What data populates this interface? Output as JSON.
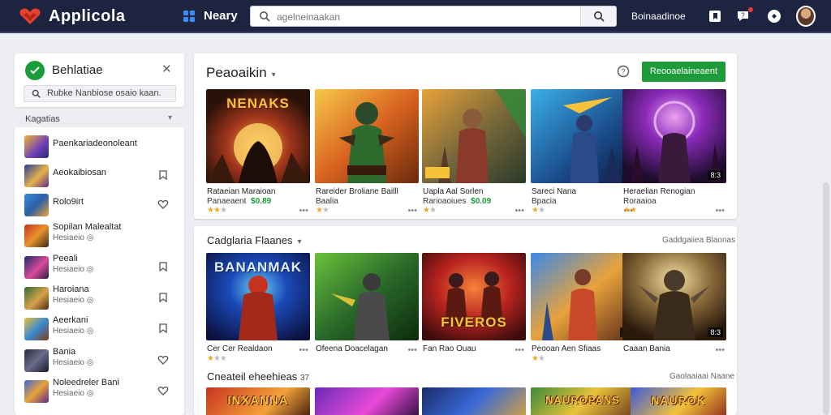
{
  "header": {
    "app_name": "Applicola",
    "nav_label": "Neary",
    "search_placeholder": "agelneinaakan",
    "top_link": "Boinaadinoe",
    "brand_color": "#1d2440"
  },
  "sidebar": {
    "title": "Behlatiae",
    "search_text": "Rubke Nanbiose osaio kaan.",
    "category_label": "Kagatias",
    "items": [
      {
        "name": "Paenkariadeonoleant",
        "sub": "",
        "action": "none"
      },
      {
        "name": "Aeokaibiosan",
        "sub": "",
        "action": "bookmark-icon"
      },
      {
        "name": "Rolo9irt",
        "sub": "",
        "action": "heart-icon"
      },
      {
        "name": "Sopilan Malealtat",
        "sub": "Hesiaeio ◎",
        "action": "none"
      },
      {
        "name": "Peeali",
        "sub": "Hesiaeio ◎",
        "action": "bookmark-icon"
      },
      {
        "name": "Haroiana",
        "sub": "Hesiaeio ◎",
        "action": "bookmark-icon"
      },
      {
        "name": "Aeerkani",
        "sub": "Hesiaeio ◎",
        "action": "bookmark-icon"
      },
      {
        "name": "Bania",
        "sub": "Hesiaeio ◎",
        "action": "heart-icon"
      },
      {
        "name": "Noleedreler Bani",
        "sub": "Hesiaeio ◎",
        "action": "heart-icon"
      }
    ]
  },
  "featured": {
    "title": "Peaoaikin",
    "cta": "Reooaelaineaent",
    "tiles": [
      {
        "art_text": "NENAKS",
        "name": "Rataeian Maraioan",
        "sub": "Panaeaent ",
        "price": "$0.89",
        "stars": 2
      },
      {
        "art_text": "",
        "name": "Rareider Broliane Bailll",
        "sub": "Baalia",
        "price": "",
        "stars": 1
      },
      {
        "art_text": "",
        "name": "Uapla Aal Sorlen",
        "sub": "Rarioaoiues ",
        "price": "$0.09",
        "stars": 1
      },
      {
        "art_text": "",
        "name": "Sareci Nana",
        "sub": "Bpacia",
        "price": "",
        "stars": 1
      },
      {
        "art_text": "",
        "name": "Heraelian Renogian",
        "sub": "Roraaioa",
        "price": "",
        "stars": 2
      }
    ]
  },
  "category": {
    "title": "Cadglaria Flaanes",
    "see_all": "Gaddgaiiea Blaonas",
    "tiles": [
      {
        "art_text": "BANANMAK",
        "name": "Cer Cer Realdaon",
        "stars": 1
      },
      {
        "art_text": "",
        "name": "Ofeena Doacelagan",
        "stars": 0
      },
      {
        "art_text": "FIVEROS",
        "name": "Fan Rao Ouau",
        "stars": 0
      },
      {
        "art_text": "",
        "name": "Peooan Aen Sfiaas",
        "stars": 1
      },
      {
        "art_text": "",
        "name": "Caaan Bania",
        "stars": 0
      }
    ]
  },
  "section3": {
    "title": "Cneateil eheehieas",
    "count": "37",
    "see_all": "Gaolaaiaai Naane",
    "tiles": [
      {
        "art_text": "INXANNA"
      },
      {
        "art_text": ""
      },
      {
        "art_text": ""
      },
      {
        "art_text": "NAUROPANS"
      },
      {
        "art_text": "NAUROK"
      }
    ]
  }
}
